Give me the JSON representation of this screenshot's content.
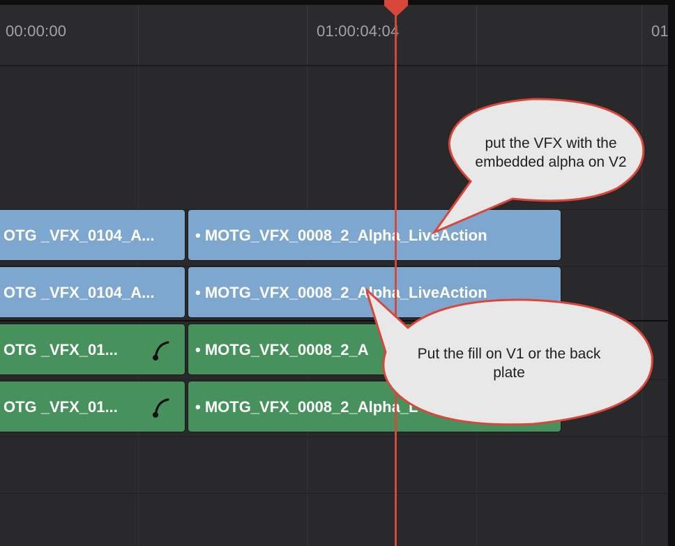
{
  "ruler": {
    "timecodes": [
      "00:00:00",
      "01:00:04:04",
      "01"
    ]
  },
  "tracks": {
    "v2": {
      "clip_left": "OTG _VFX_0104_A...",
      "clip_right": "• MOTG_VFX_0008_2_Alpha_LiveAction"
    },
    "v1": {
      "clip_left": "OTG _VFX_0104_A...",
      "clip_right": "• MOTG_VFX_0008_2_Alpha_LiveAction"
    },
    "a1": {
      "clip_left": "OTG _VFX_01...",
      "clip_right": "• MOTG_VFX_0008_2_A"
    },
    "a2": {
      "clip_left": "OTG _VFX_01...",
      "clip_right": "• MOTG_VFX_0008_2_Alpha_L"
    }
  },
  "callouts": {
    "top": {
      "line1": "put the VFX with the",
      "line2": "embedded alpha on V2"
    },
    "bottom": {
      "line1": "Put the fill on V1 or the back",
      "line2": "plate"
    }
  },
  "colors": {
    "video_clip": "#7ea7cf",
    "audio_clip": "#47915c",
    "playhead": "#d9463a",
    "callout_fill": "#e8e8e8",
    "callout_stroke": "#d9463a"
  }
}
